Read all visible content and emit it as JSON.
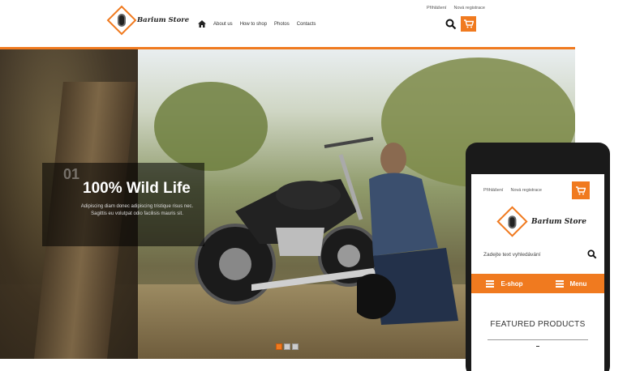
{
  "header": {
    "top_links": [
      "Přihlášení",
      "Nová registrace"
    ],
    "logo_text": "Barium Store",
    "nav": [
      "About us",
      "How to shop",
      "Photos",
      "Contacts"
    ]
  },
  "slider": {
    "number": "01",
    "title": "100% Wild Life",
    "description": "Adipiscing diam donec adipiscing tristique risus nec. Sagittis eu volutpat odio facilisis mauris sit.",
    "dots": [
      true,
      false,
      false
    ]
  },
  "mobile": {
    "top_links": [
      "Přihlášení",
      "Nová registrace"
    ],
    "logo_text": "Barium Store",
    "search_placeholder": "Zadejte text vyhledávání",
    "eshop_label": "E-shop",
    "menu_label": "Menu",
    "featured_title": "FEATURED PRODUCTS"
  },
  "colors": {
    "accent": "#f07a1f"
  },
  "icons": [
    "home-icon",
    "search-icon",
    "cart-icon",
    "hamburger-icon"
  ]
}
